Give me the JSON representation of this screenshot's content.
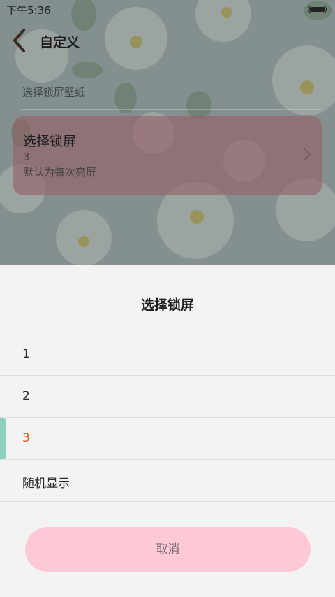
{
  "status_bar": {
    "time": "下午5:36",
    "battery_icon": "battery-icon"
  },
  "header": {
    "title": "自定义",
    "back_icon": "chevron-left-icon"
  },
  "settings": {
    "wallpaper_label": "选择锁屏壁纸",
    "lock_card": {
      "title": "选择锁屏",
      "value": "3",
      "description": "默认为每次亮屏",
      "chevron_icon": "chevron-right-icon"
    }
  },
  "sheet": {
    "title": "选择锁屏",
    "options": [
      {
        "label": "1",
        "selected": false
      },
      {
        "label": "2",
        "selected": false
      },
      {
        "label": "3",
        "selected": true
      },
      {
        "label": "随机显示",
        "selected": false
      }
    ],
    "cancel_label": "取消"
  },
  "colors": {
    "selected_text": "#e8561c",
    "selected_marker": "#8ecfbe",
    "cancel_button": "#fdc9d6",
    "card_tint": "#946068"
  }
}
